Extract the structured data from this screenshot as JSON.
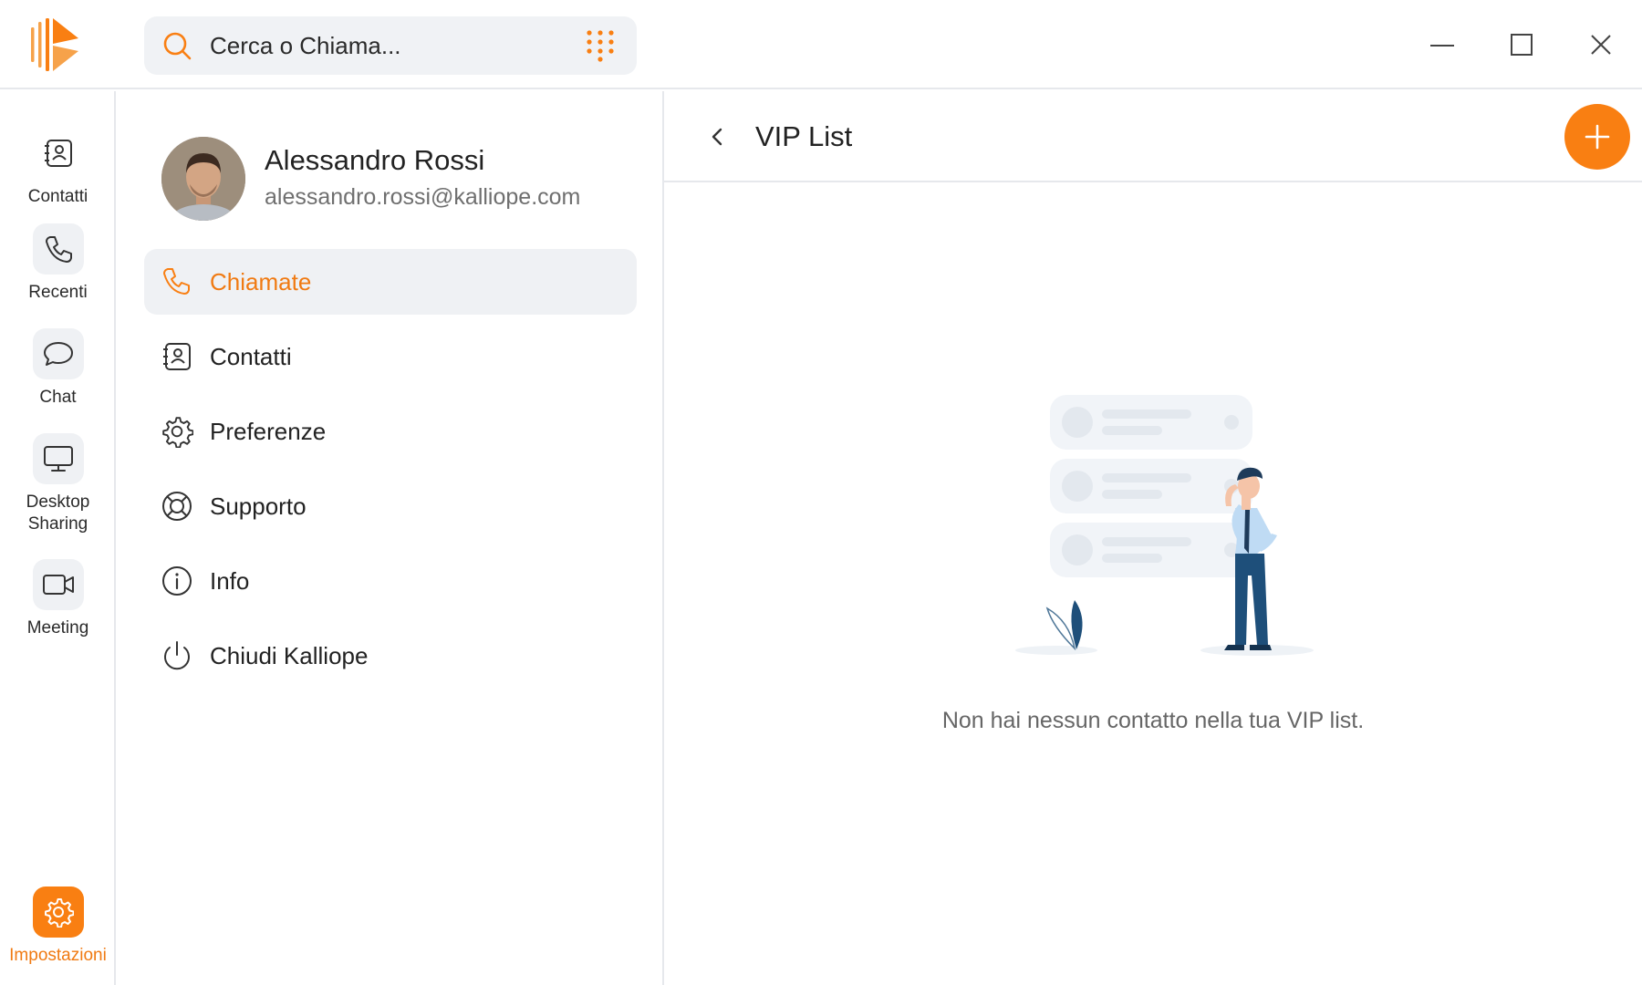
{
  "search": {
    "placeholder": "Cerca o Chiama..."
  },
  "rail": {
    "items": [
      {
        "label": "Contatti",
        "icon": "contacts-book-icon"
      },
      {
        "label": "Recenti",
        "icon": "phone-icon"
      },
      {
        "label": "Chat",
        "icon": "chat-bubble-icon"
      },
      {
        "label_line1": "Desktop",
        "label_line2": "Sharing",
        "icon": "monitor-icon"
      },
      {
        "label": "Meeting",
        "icon": "video-camera-icon"
      }
    ],
    "settings": {
      "label": "Impostazioni",
      "icon": "gear-icon"
    }
  },
  "profile": {
    "name": "Alessandro Rossi",
    "email": "alessandro.rossi@kalliope.com"
  },
  "menu": [
    {
      "label": "Chiamate",
      "icon": "phone-icon",
      "active": true
    },
    {
      "label": "Contatti",
      "icon": "contacts-book-icon"
    },
    {
      "label": "Preferenze",
      "icon": "gear-icon"
    },
    {
      "label": "Supporto",
      "icon": "lifebuoy-icon"
    },
    {
      "label": "Info",
      "icon": "info-icon"
    },
    {
      "label": "Chiudi Kalliope",
      "icon": "power-icon"
    }
  ],
  "main": {
    "title": "VIP List",
    "empty_message": "Non hai nessun contatto nella tua VIP list."
  },
  "colors": {
    "accent": "#f97f12",
    "surface": "#eff1f4",
    "navy": "#1e4f7a"
  }
}
